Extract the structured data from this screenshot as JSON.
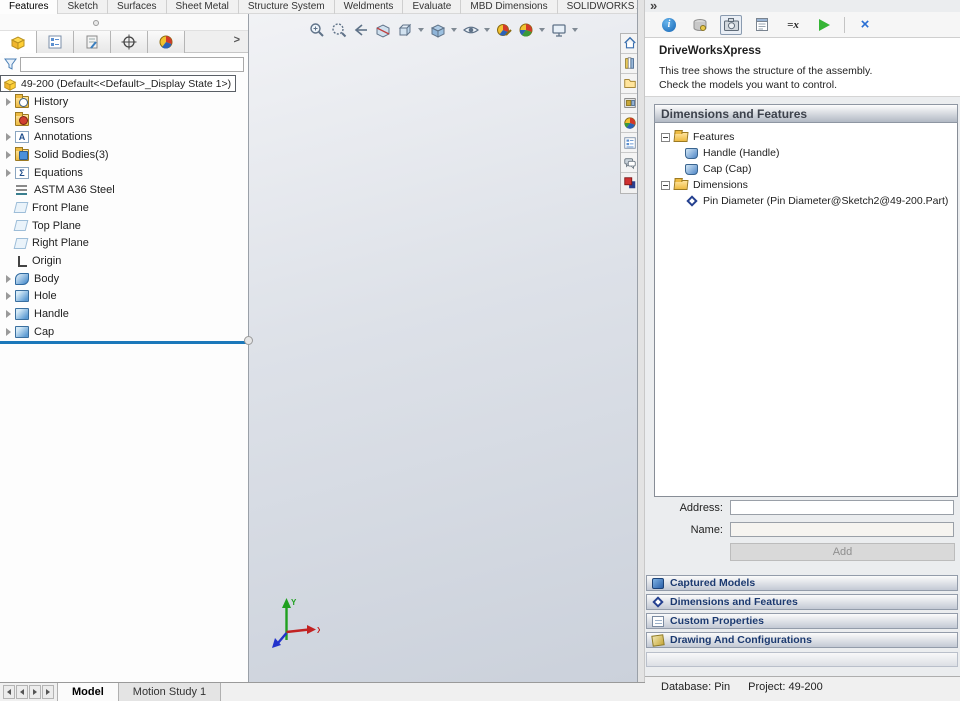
{
  "icons": {
    "flyout_chevron": ">",
    "panel_chevrons": "»",
    "close_x": "×",
    "info_i": "i",
    "variables": "=x",
    "annotations_letter": "A",
    "equations_sigma": "Σ"
  },
  "tab_bar": {
    "tabs": [
      {
        "label": "Features",
        "active": true
      },
      {
        "label": "Sketch",
        "active": false
      },
      {
        "label": "Surfaces",
        "active": false
      },
      {
        "label": "Sheet Metal",
        "active": false
      },
      {
        "label": "Structure System",
        "active": false
      },
      {
        "label": "Weldments",
        "active": false
      },
      {
        "label": "Evaluate",
        "active": false
      },
      {
        "label": "MBD Dimensions",
        "active": false
      },
      {
        "label": "SOLIDWORKS Add-Ins",
        "active": false
      }
    ]
  },
  "feature_manager": {
    "document_label": "49-200  (Default<<Default>_Display State 1>)",
    "filter_value": "",
    "items": [
      {
        "label": "History"
      },
      {
        "label": "Sensors"
      },
      {
        "label": "Annotations"
      },
      {
        "label": "Solid Bodies(3)"
      },
      {
        "label": "Equations"
      },
      {
        "label": "ASTM A36 Steel"
      },
      {
        "label": "Front Plane"
      },
      {
        "label": "Top Plane"
      },
      {
        "label": "Right Plane"
      },
      {
        "label": "Origin"
      },
      {
        "label": "Body"
      },
      {
        "label": "Hole"
      },
      {
        "label": "Handle"
      },
      {
        "label": "Cap"
      }
    ]
  },
  "viewport": {
    "triad": {
      "x": "X",
      "y": "Y"
    }
  },
  "task_pane": {
    "title": "DriveWorksXpress",
    "description_line1": "This tree shows the structure of the assembly.",
    "description_line2": "Check the models you want to control.",
    "section_header": "Dimensions and Features",
    "tree": [
      {
        "label": "Features"
      },
      {
        "label": "Handle (Handle)"
      },
      {
        "label": "Cap (Cap)"
      },
      {
        "label": "Dimensions"
      },
      {
        "label": "Pin Diameter (Pin Diameter@Sketch2@49-200.Part)"
      }
    ],
    "address_label": "Address:",
    "name_label": "Name:",
    "address_value": "",
    "name_value": "",
    "add_button": "Add",
    "accordions": [
      {
        "label": "Captured Models"
      },
      {
        "label": "Dimensions and Features"
      },
      {
        "label": "Custom Properties"
      },
      {
        "label": "Drawing And Configurations"
      }
    ],
    "status": {
      "database": "Database: Pin",
      "project": "Project: 49-200"
    }
  },
  "bottom_bar": {
    "tabs": [
      {
        "label": "Model",
        "active": true
      },
      {
        "label": "Motion Study 1",
        "active": false
      }
    ]
  }
}
